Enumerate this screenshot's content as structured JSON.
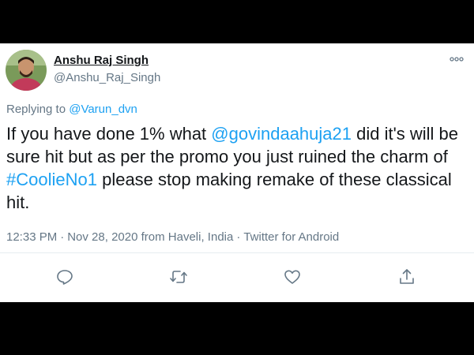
{
  "tweet": {
    "author": {
      "display_name": "Anshu Raj Singh",
      "handle": "@Anshu_Raj_Singh",
      "avatar_icon": "user-avatar"
    },
    "replying_to_label": "Replying to",
    "replying_to_handle": "@Varun_dvn",
    "body": {
      "t1": "If you have done 1% what ",
      "mention": "@govindaahuja21",
      "t2": "  did it's will be sure hit but as per the promo you just ruined the charm of ",
      "hashtag": "#CoolieNo1",
      "t3": " please stop making remake of these classical hit."
    },
    "meta": {
      "time": "12:33 PM",
      "date": "Nov 28, 2020",
      "location": "from Haveli, India",
      "client": "Twitter for Android",
      "separator": "·"
    },
    "actions": [
      "reply-icon",
      "retweet-icon",
      "like-icon",
      "share-icon"
    ]
  },
  "colors": {
    "text": "#14171a",
    "secondary": "#657786",
    "link": "#1da1f2",
    "divider": "#e6ecf0",
    "letterbox": "#000000"
  }
}
